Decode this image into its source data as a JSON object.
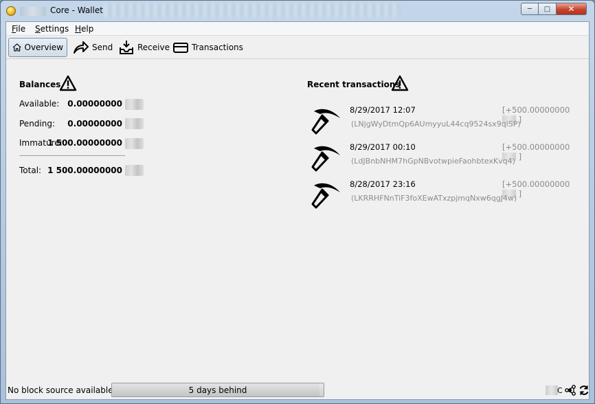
{
  "window": {
    "title": "Core - Wallet"
  },
  "menu": {
    "items": [
      "File",
      "Settings",
      "Help"
    ]
  },
  "toolbar": {
    "items": [
      {
        "label": "Overview",
        "icon": "home-icon",
        "active": true
      },
      {
        "label": "Send",
        "icon": "send-arrow-icon",
        "active": false
      },
      {
        "label": "Receive",
        "icon": "receive-inbox-icon",
        "active": false
      },
      {
        "label": "Transactions",
        "icon": "card-icon",
        "active": false
      }
    ]
  },
  "balances": {
    "title": "Balances",
    "rows": [
      {
        "label": "Available:",
        "value": "0.00000000"
      },
      {
        "label": "Pending:",
        "value": "0.00000000"
      },
      {
        "label": "Immature:",
        "value": "1 500.00000000"
      }
    ],
    "total": {
      "label": "Total:",
      "value": "1 500.00000000"
    }
  },
  "recent": {
    "title": "Recent transactions",
    "items": [
      {
        "date": "8/29/2017 12:07",
        "amount_prefix": "[+500.00000000",
        "amount_suffix": "]",
        "address": "(LNjgWyDtmQp6AUmyyuL44cq9524sx9qiSP)",
        "icon": "mining-pickaxe-icon"
      },
      {
        "date": "8/29/2017 00:10",
        "amount_prefix": "[+500.00000000",
        "amount_suffix": "]",
        "address": "(LdJBnbNHM7hGpNBvotwpieFaohbtexKvq4)",
        "icon": "mining-pickaxe-icon"
      },
      {
        "date": "8/28/2017 23:16",
        "amount_prefix": "[+500.00000000",
        "amount_suffix": "]",
        "address": "(LKRRHFNnTiF3foXEwATxzpjmqNxw6qgJ4w)",
        "icon": "mining-pickaxe-icon"
      }
    ]
  },
  "status": {
    "message": "No block source available...",
    "progress_label": "5 days behind",
    "unit_suffix": "C"
  }
}
